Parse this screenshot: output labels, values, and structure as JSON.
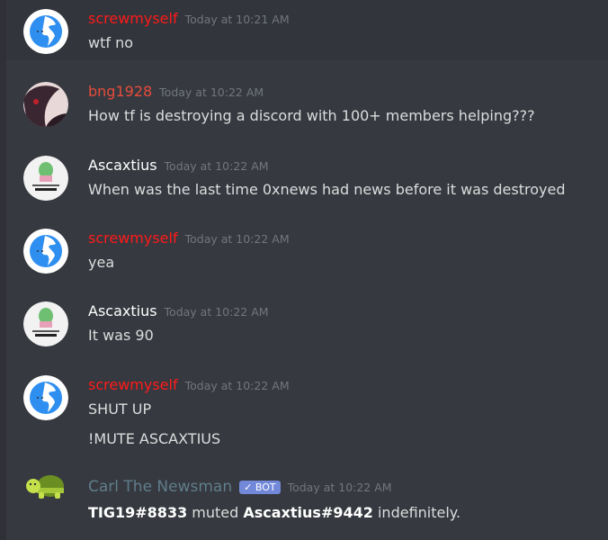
{
  "colors": {
    "screwmyself": "#ff1a1a",
    "bng1928": "#e74c3c",
    "Ascaxtius": "#ffffff",
    "bot": "#607d8b",
    "bot_badge": "#7289da"
  },
  "messages": [
    {
      "author": "screwmyself",
      "time": "Today at 10:21 AM",
      "avatar": "globe-avatar",
      "lines": [
        "wtf no"
      ]
    },
    {
      "author": "bng1928",
      "time": "Today at 10:22 AM",
      "avatar": "anime-avatar",
      "lines": [
        "How tf is destroying a discord with 100+ members helping???"
      ]
    },
    {
      "author": "Ascaxtius",
      "time": "Today at 10:22 AM",
      "avatar": "cactus-avatar",
      "lines": [
        "When was the last time 0xnews had news before it was destroyed"
      ]
    },
    {
      "author": "screwmyself",
      "time": "Today at 10:22 AM",
      "avatar": "globe-avatar",
      "lines": [
        "yea"
      ]
    },
    {
      "author": "Ascaxtius",
      "time": "Today at 10:22 AM",
      "avatar": "cactus-avatar",
      "lines": [
        "It was 90"
      ]
    },
    {
      "author": "screwmyself",
      "time": "Today at 10:22 AM",
      "avatar": "globe-avatar",
      "lines": [
        "SHUT UP",
        "!MUTE ASCAXTIUS"
      ]
    }
  ],
  "bot_message": {
    "author": "Carl The Newsman",
    "badge": "✓ BOT",
    "time": "Today at 10:22 AM",
    "avatar": "turtle-avatar",
    "moderator": "TIG19#8833",
    "action": "muted",
    "target": "Ascaxtius#9442",
    "suffix": "indefinitely."
  }
}
